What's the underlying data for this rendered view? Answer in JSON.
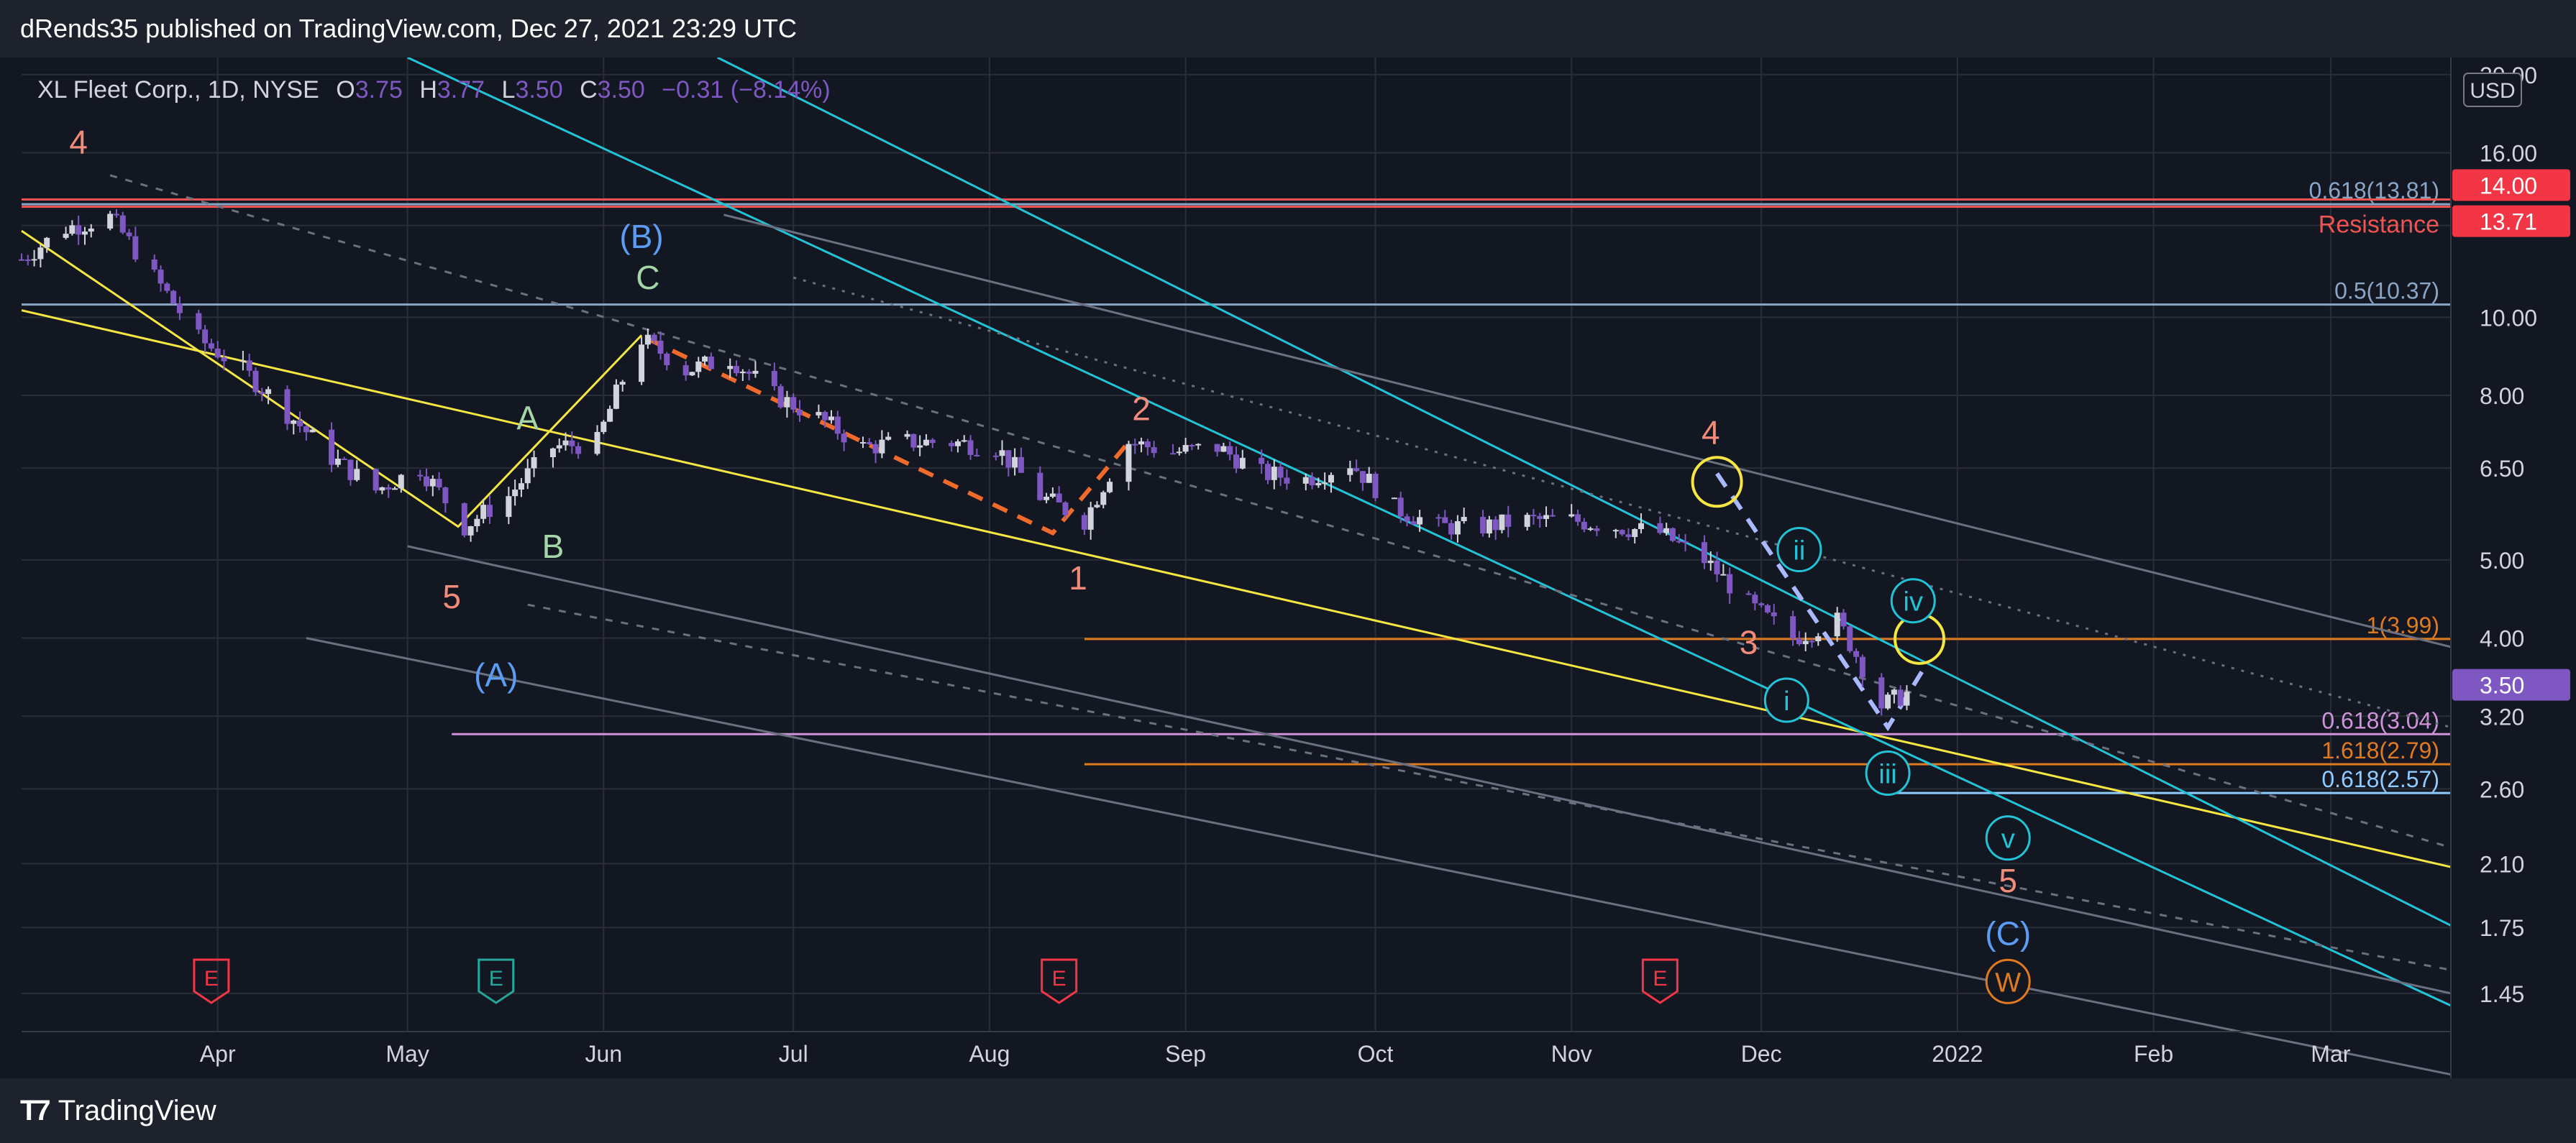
{
  "header": {
    "publisher": "dRends35 published on TradingView.com, Dec 27, 2021 23:29 UTC"
  },
  "footer": {
    "brand": "TradingView",
    "logo_icon": "tradingview-logo-icon"
  },
  "colors": {
    "bg": "#131722",
    "grid": "#2a2e39",
    "up": "#d1d4dc",
    "down": "#7e57c2",
    "yellow": "#f5e642",
    "cyan": "#22c3d6",
    "red": "#f05350",
    "salmon": "#f28b7a",
    "orange": "#e07a1f",
    "blue": "#5b9cf5",
    "green": "#a5d6a7",
    "violet": "#ce93d8",
    "fib": "#8aa6c7"
  },
  "chart_data": {
    "type": "candlestick",
    "symbol": "XL Fleet Corp., 1D, NYSE",
    "ohlc": {
      "o_label": "O",
      "o": "3.75",
      "h_label": "H",
      "h": "3.77",
      "l_label": "L",
      "l": "3.50",
      "c_label": "C",
      "c": "3.50",
      "change": "−0.31 (−8.14%)"
    },
    "currency": "USD",
    "y_scale": "log",
    "ylim": [
      1.3,
      21
    ],
    "y_ticks": [
      "20.00",
      "16.00",
      "13.00",
      "10.00",
      "8.00",
      "6.50",
      "5.00",
      "4.00",
      "3.20",
      "2.60",
      "2.10",
      "1.75",
      "1.45"
    ],
    "x_range": [
      "2021-03-01",
      "2022-03-20"
    ],
    "x_ticks": [
      {
        "label": "Apr",
        "date": "2021-04-01"
      },
      {
        "label": "May",
        "date": "2021-05-01"
      },
      {
        "label": "Jun",
        "date": "2021-06-01"
      },
      {
        "label": "Jul",
        "date": "2021-07-01"
      },
      {
        "label": "Aug",
        "date": "2021-08-01"
      },
      {
        "label": "Sep",
        "date": "2021-09-01"
      },
      {
        "label": "Oct",
        "date": "2021-10-01"
      },
      {
        "label": "Nov",
        "date": "2021-11-01"
      },
      {
        "label": "Dec",
        "date": "2021-12-01"
      },
      {
        "label": "2022",
        "date": "2022-01-01"
      },
      {
        "label": "Feb",
        "date": "2022-02-01"
      },
      {
        "label": "Mar",
        "date": "2022-03-01"
      }
    ],
    "price_badges": [
      {
        "value": "14.00",
        "price": 14.0,
        "color": "#f23645"
      },
      {
        "value": "13.71",
        "price": 13.71,
        "color": "#f23645"
      },
      {
        "value": "3.50",
        "price": 3.5,
        "color": "#7e57c2"
      }
    ],
    "horizontal_levels": [
      {
        "label": "0.618(13.81)",
        "price": 13.81,
        "color": "#8aa6c7",
        "start": "2021-03-01"
      },
      {
        "label": "",
        "price": 14.0,
        "color": "#f05350",
        "start": "2021-03-01"
      },
      {
        "label": "",
        "price": 13.71,
        "color": "#f05350",
        "start": "2021-03-01"
      },
      {
        "label": "0.5(10.37)",
        "price": 10.37,
        "color": "#8aa6c7",
        "start": "2021-03-01"
      },
      {
        "label": "1(3.99)",
        "price": 3.99,
        "color": "#e07a1f",
        "start": "2021-08-16"
      },
      {
        "label": "0.618(3.04)",
        "price": 3.04,
        "color": "#ce93d8",
        "start": "2021-05-08"
      },
      {
        "label": "1.618(2.79)",
        "price": 2.79,
        "color": "#e07a1f",
        "start": "2021-08-16"
      },
      {
        "label": "0.618(2.57)",
        "price": 2.57,
        "color": "#8ecbff",
        "start": "2021-12-22"
      }
    ],
    "resistance_label": "Resistance",
    "closes": [
      {
        "d": "2021-03-01",
        "c": 11.8
      },
      {
        "d": "2021-03-08",
        "c": 12.9
      },
      {
        "d": "2021-03-15",
        "c": 13.3
      },
      {
        "d": "2021-03-22",
        "c": 11.2
      },
      {
        "d": "2021-03-29",
        "c": 9.4
      },
      {
        "d": "2021-04-05",
        "c": 8.6
      },
      {
        "d": "2021-04-12",
        "c": 7.6
      },
      {
        "d": "2021-04-19",
        "c": 6.7
      },
      {
        "d": "2021-04-26",
        "c": 6.1
      },
      {
        "d": "2021-05-03",
        "c": 6.5
      },
      {
        "d": "2021-05-10",
        "c": 5.5
      },
      {
        "d": "2021-05-17",
        "c": 6.0
      },
      {
        "d": "2021-05-24",
        "c": 6.9
      },
      {
        "d": "2021-05-31",
        "c": 7.0
      },
      {
        "d": "2021-06-07",
        "c": 9.4
      },
      {
        "d": "2021-06-14",
        "c": 8.6
      },
      {
        "d": "2021-06-21",
        "c": 8.9
      },
      {
        "d": "2021-06-28",
        "c": 8.0
      },
      {
        "d": "2021-07-05",
        "c": 7.5
      },
      {
        "d": "2021-07-12",
        "c": 6.9
      },
      {
        "d": "2021-07-19",
        "c": 7.0
      },
      {
        "d": "2021-07-26",
        "c": 7.0
      },
      {
        "d": "2021-08-02",
        "c": 6.9
      },
      {
        "d": "2021-08-09",
        "c": 6.0
      },
      {
        "d": "2021-08-16",
        "c": 5.6
      },
      {
        "d": "2021-08-23",
        "c": 7.0
      },
      {
        "d": "2021-08-30",
        "c": 6.8
      },
      {
        "d": "2021-09-06",
        "c": 6.9
      },
      {
        "d": "2021-09-13",
        "c": 6.4
      },
      {
        "d": "2021-09-20",
        "c": 6.3
      },
      {
        "d": "2021-09-27",
        "c": 6.6
      },
      {
        "d": "2021-10-04",
        "c": 5.8
      },
      {
        "d": "2021-10-11",
        "c": 5.5
      },
      {
        "d": "2021-10-18",
        "c": 5.5
      },
      {
        "d": "2021-10-25",
        "c": 5.6
      },
      {
        "d": "2021-11-01",
        "c": 5.6
      },
      {
        "d": "2021-11-08",
        "c": 5.5
      },
      {
        "d": "2021-11-15",
        "c": 5.4
      },
      {
        "d": "2021-11-22",
        "c": 5.0
      },
      {
        "d": "2021-11-29",
        "c": 4.4
      },
      {
        "d": "2021-12-06",
        "c": 4.0
      },
      {
        "d": "2021-12-13",
        "c": 4.2
      },
      {
        "d": "2021-12-20",
        "c": 3.3
      },
      {
        "d": "2021-12-27",
        "c": 3.5
      }
    ],
    "trend_lines": [
      {
        "color": "#f5e642",
        "style": "solid",
        "points": [
          {
            "d": "2021-03-01",
            "p": 10.2
          },
          {
            "d": "2022-03-20",
            "p": 2.08
          }
        ]
      },
      {
        "color": "#f5e642",
        "style": "solid",
        "points": [
          {
            "d": "2021-03-01",
            "p": 12.8
          },
          {
            "d": "2021-05-09",
            "p": 5.5
          },
          {
            "d": "2021-06-07",
            "p": 9.5
          }
        ]
      },
      {
        "color": "#22c3d6",
        "style": "solid",
        "points": [
          {
            "d": "2021-06-19",
            "p": 21
          },
          {
            "d": "2022-03-20",
            "p": 1.76
          }
        ]
      },
      {
        "color": "#22c3d6",
        "style": "solid",
        "points": [
          {
            "d": "2021-05-01",
            "p": 21
          },
          {
            "d": "2022-03-20",
            "p": 1.4
          }
        ]
      },
      {
        "color": "#6b7080",
        "style": "solid",
        "points": [
          {
            "d": "2021-06-20",
            "p": 13.4
          },
          {
            "d": "2022-03-20",
            "p": 3.9
          }
        ]
      },
      {
        "color": "#6b7080",
        "style": "solid",
        "points": [
          {
            "d": "2021-05-01",
            "p": 5.2
          },
          {
            "d": "2022-03-20",
            "p": 1.45
          }
        ]
      },
      {
        "color": "#6b7080",
        "style": "solid",
        "points": [
          {
            "d": "2021-04-15",
            "p": 4.0
          },
          {
            "d": "2022-03-20",
            "p": 1.15
          }
        ]
      },
      {
        "color": "#6b7080",
        "style": "dashed",
        "points": [
          {
            "d": "2021-03-15",
            "p": 15.0
          },
          {
            "d": "2022-03-20",
            "p": 2.2
          }
        ]
      },
      {
        "color": "#6b7080",
        "style": "dashed",
        "points": [
          {
            "d": "2021-05-20",
            "p": 4.4
          },
          {
            "d": "2022-03-20",
            "p": 1.55
          }
        ]
      },
      {
        "color": "#6b7080",
        "style": "dotted",
        "points": [
          {
            "d": "2021-07-01",
            "p": 11.2
          },
          {
            "d": "2022-03-20",
            "p": 3.1
          }
        ]
      },
      {
        "color": "#f06a2c",
        "style": "dashed",
        "points": [
          {
            "d": "2021-06-08",
            "p": 9.4
          },
          {
            "d": "2021-08-11",
            "p": 5.4
          },
          {
            "d": "2021-08-23",
            "p": 7.0
          }
        ]
      },
      {
        "color": "#aab8ff",
        "style": "dashed",
        "points": [
          {
            "d": "2021-11-24",
            "p": 6.4
          },
          {
            "d": "2021-12-21",
            "p": 3.1
          },
          {
            "d": "2021-12-27",
            "p": 3.7
          }
        ]
      }
    ],
    "circles": [
      {
        "d": "2021-11-24",
        "p": 6.25,
        "color": "#f5e642"
      },
      {
        "d": "2021-12-26",
        "p": 3.99,
        "color": "#f5e642"
      }
    ],
    "wave_labels": [
      {
        "text": "4",
        "d": "2021-03-10",
        "p": 16.5,
        "color": "#f28b7a",
        "circle": false
      },
      {
        "text": "(B)",
        "d": "2021-06-07",
        "p": 12.6,
        "color": "#5b9cf5",
        "circle": false
      },
      {
        "text": "C",
        "d": "2021-06-08",
        "p": 11.2,
        "color": "#a5d6a7",
        "circle": false
      },
      {
        "text": "A",
        "d": "2021-05-20",
        "p": 7.5,
        "color": "#a5d6a7",
        "circle": false
      },
      {
        "text": "B",
        "d": "2021-05-24",
        "p": 5.2,
        "color": "#a5d6a7",
        "circle": false
      },
      {
        "text": "5",
        "d": "2021-05-08",
        "p": 4.5,
        "color": "#f28b7a",
        "circle": false
      },
      {
        "text": "(A)",
        "d": "2021-05-15",
        "p": 3.6,
        "color": "#5b9cf5",
        "circle": false
      },
      {
        "text": "2",
        "d": "2021-08-25",
        "p": 7.7,
        "color": "#f28b7a",
        "circle": false
      },
      {
        "text": "1",
        "d": "2021-08-15",
        "p": 4.75,
        "color": "#f28b7a",
        "circle": false
      },
      {
        "text": "4",
        "d": "2021-11-23",
        "p": 7.2,
        "color": "#f28b7a",
        "circle": false
      },
      {
        "text": "3",
        "d": "2021-11-29",
        "p": 3.95,
        "color": "#f28b7a",
        "circle": false
      },
      {
        "text": "ii",
        "d": "2021-12-07",
        "p": 5.15,
        "color": "#22c3d6",
        "circle": true
      },
      {
        "text": "i",
        "d": "2021-12-05",
        "p": 3.35,
        "color": "#22c3d6",
        "circle": true
      },
      {
        "text": "iv",
        "d": "2021-12-25",
        "p": 4.45,
        "color": "#22c3d6",
        "circle": true
      },
      {
        "text": "iii",
        "d": "2021-12-21",
        "p": 2.72,
        "color": "#22c3d6",
        "circle": true
      },
      {
        "text": "v",
        "d": "2022-01-09",
        "p": 2.26,
        "color": "#22c3d6",
        "circle": true
      },
      {
        "text": "5",
        "d": "2022-01-09",
        "p": 2.0,
        "color": "#f28b7a",
        "circle": false
      },
      {
        "text": "(C)",
        "d": "2022-01-09",
        "p": 1.72,
        "color": "#5b9cf5",
        "circle": false
      },
      {
        "text": "W",
        "d": "2022-01-09",
        "p": 1.5,
        "color": "#e07a1f",
        "circle": true
      }
    ],
    "earnings_markers": [
      {
        "text": "E",
        "d": "2021-03-31",
        "color": "#f23645"
      },
      {
        "text": "E",
        "d": "2021-05-15",
        "color": "#26a69a"
      },
      {
        "text": "E",
        "d": "2021-08-12",
        "color": "#f23645"
      },
      {
        "text": "E",
        "d": "2021-11-15",
        "color": "#f23645"
      }
    ]
  }
}
